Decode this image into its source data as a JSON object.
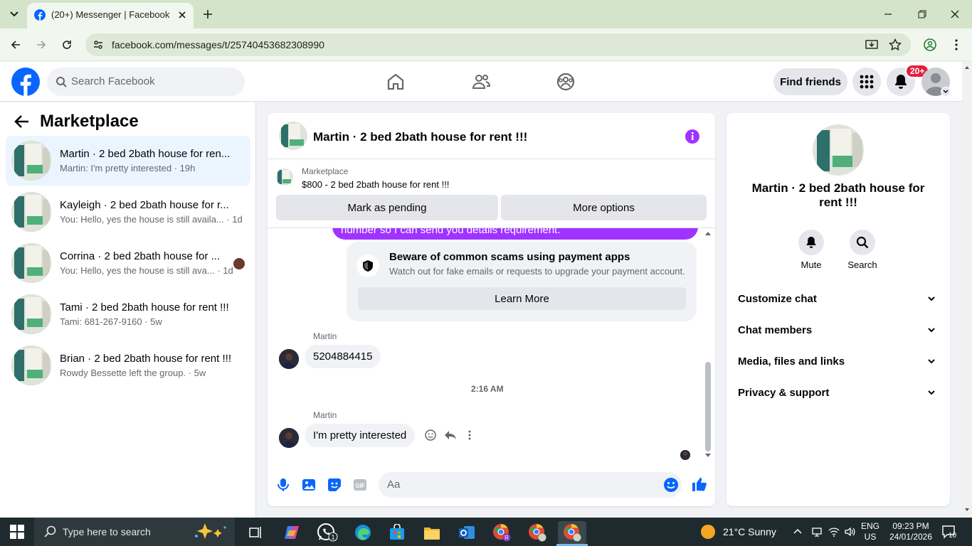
{
  "browser": {
    "tab_title": "(20+) Messenger | Facebook",
    "url": "facebook.com/messages/t/25740453682308990"
  },
  "fb_nav": {
    "search_placeholder": "Search Facebook",
    "find_friends": "Find friends",
    "notifications_badge": "20+"
  },
  "left_panel": {
    "title": "Marketplace",
    "conversations": [
      {
        "name": "Martin · 2 bed 2bath house for ren...",
        "preview": "Martin: I'm pretty interested · 19h",
        "active": true
      },
      {
        "name": "Kayleigh · 2 bed 2bath house for r...",
        "preview": "You: Hello, yes the house is still availa...  · 1d"
      },
      {
        "name": "Corrina · 2 bed 2bath house for ...",
        "preview": "You: Hello, yes the house is still ava...  · 1d"
      },
      {
        "name": "Tami · 2 bed 2bath house for rent !!!",
        "preview": "Tami: 681-267-9160 · 5w"
      },
      {
        "name": "Brian · 2 bed 2bath house for rent !!!",
        "preview": "Rowdy Bessette left the group. · 5w"
      }
    ]
  },
  "chat": {
    "header_title": "Martin · 2 bed 2bath house for rent !!!",
    "marketplace_label": "Marketplace",
    "listing_price_title": "$800 - 2 bed 2bath house for rent !!!",
    "mark_pending": "Mark as pending",
    "more_options": "More options",
    "partial_message": "number so I can send you details requirement.",
    "scam_title": "Beware of common scams using payment apps",
    "scam_desc": "Watch out for fake emails or requests to upgrade your payment account.",
    "learn_more": "Learn More",
    "messages": [
      {
        "sender": "Martin",
        "text": "5204884415"
      },
      {
        "sender": "Martin",
        "text": "I'm pretty interested"
      }
    ],
    "timestamp": "2:16 AM",
    "composer_placeholder": "Aa"
  },
  "right_panel": {
    "title": "Martin · 2 bed 2bath house for rent !!!",
    "actions": {
      "mute": "Mute",
      "search": "Search"
    },
    "sections": [
      "Customize chat",
      "Chat members",
      "Media, files and links",
      "Privacy & support"
    ]
  },
  "taskbar": {
    "search_placeholder": "Type here to search",
    "weather": "21°C  Sunny",
    "lang_1": "ENG",
    "lang_2": "US",
    "time": "09:23 PM",
    "date": "24/01/2026",
    "notification_count": "10",
    "whatsapp_badge": "1"
  },
  "colors": {
    "fb_blue": "#0866ff",
    "messenger_purple": "#a033ff",
    "notif_red": "#e41e3f"
  }
}
